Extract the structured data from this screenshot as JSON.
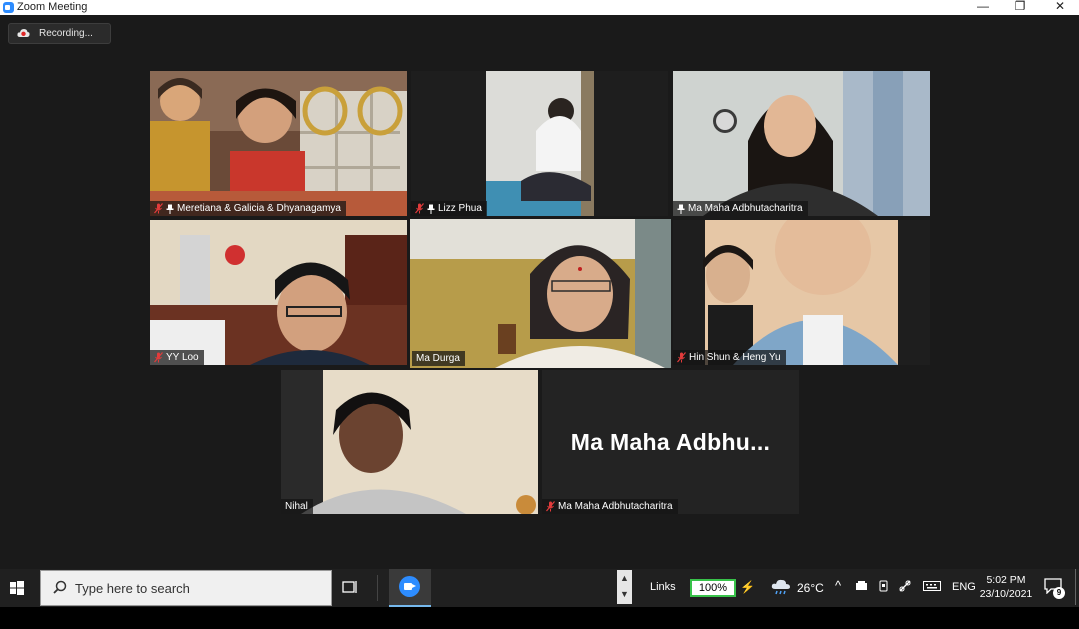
{
  "window": {
    "title": "Zoom Meeting",
    "minimize": "—",
    "restore": "❐",
    "close": "✕"
  },
  "recording": {
    "label": "Recording..."
  },
  "participants": [
    {
      "name": "Meretiana & Galicia & Dhyanagamya",
      "muted": true,
      "pinned": true
    },
    {
      "name": "Lizz Phua",
      "muted": true,
      "pinned": true
    },
    {
      "name": "Ma Maha Adbhutacharitra",
      "muted": false,
      "pinned": true
    },
    {
      "name": "YY Loo",
      "muted": true,
      "pinned": false
    },
    {
      "name": "Ma Durga",
      "muted": false,
      "pinned": false,
      "active_speaker": true
    },
    {
      "name": "Hin Shun & Heng Yu",
      "muted": true,
      "pinned": false
    },
    {
      "name": "Nihal",
      "muted": false,
      "pinned": false
    },
    {
      "name": "Ma Maha Adbhutacharitra",
      "muted": true,
      "pinned": false,
      "video_off": true,
      "display_name": "Ma Maha Adbhu..."
    }
  ],
  "taskbar": {
    "search_placeholder": "Type here to search",
    "links_label": "Links",
    "battery": "100%",
    "temperature": "26°C",
    "language": "ENG",
    "time": "5:02 PM",
    "date": "23/10/2021",
    "notification_count": "9",
    "scroll_up": "▲",
    "scroll_down": "▼",
    "tray_chevron": "^"
  },
  "colors": {
    "active_speaker_border": "#c9e57b",
    "meeting_bg": "#1a1a1a",
    "zoom_blue": "#2d8cff",
    "battery_green": "#38c24a"
  }
}
